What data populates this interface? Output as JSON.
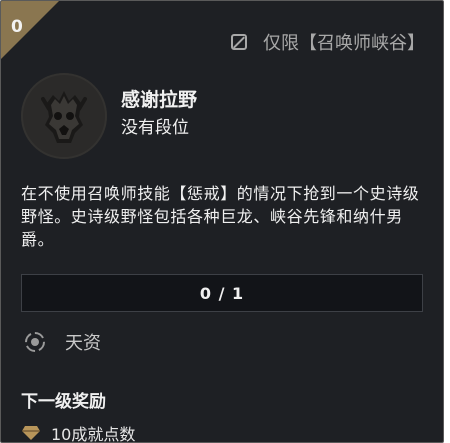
{
  "card": {
    "corner_level": "0",
    "mode_label": "仅限【召唤师峡谷】",
    "mode_icon": "slash-square-icon",
    "emblem_icon": "jungle-monster-emblem-icon",
    "title": "感谢拉野",
    "rank": "没有段位",
    "description": "在不使用召唤师技能【惩戒】的情况下抢到一个史诗级野怪。史诗级野怪包括各种巨龙、峡谷先锋和纳什男爵。",
    "progress": {
      "text": "0 / 1",
      "current": 0,
      "total": 1
    },
    "category": {
      "icon": "target-ring-icon",
      "label": "天资"
    },
    "next_reward": {
      "title": "下一级奖励",
      "icon": "gem-icon",
      "text": "10成就点数"
    },
    "colors": {
      "background": "#1e2024",
      "accent_gold": "#8a7650",
      "text": "#f0f0f0",
      "muted": "#a8a8a8"
    }
  }
}
